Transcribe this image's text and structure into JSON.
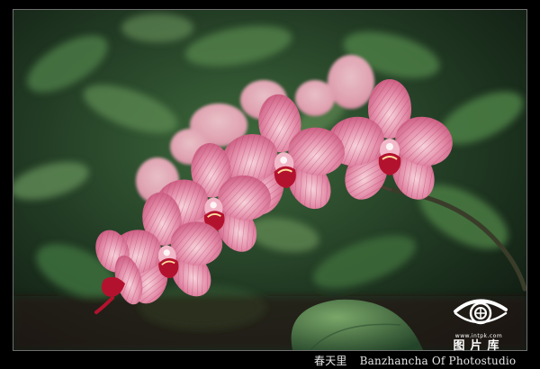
{
  "caption": {
    "chinese": "春天里",
    "english": "Banzhancha Of Photostudio"
  },
  "watermark": {
    "url": "www.intpk.com",
    "name": "图片库",
    "logo_icon": "eye-camera-logo-icon"
  },
  "colors": {
    "background": "#000000",
    "frame_border": "#6f6f6f",
    "foliage_dark": "#1e3320",
    "foliage_light": "#6f9a5e",
    "petal_pink": "#e28aa8",
    "petal_light": "#f3c2cf",
    "petal_vein": "#b8405f",
    "lip_red": "#b3122e",
    "caption_text": "#e6e6e6"
  }
}
